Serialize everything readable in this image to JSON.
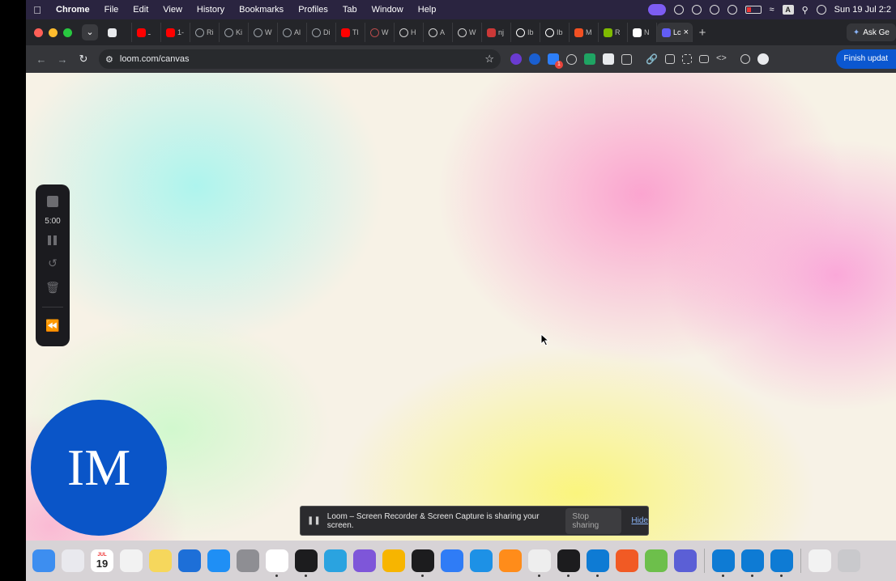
{
  "menubar": {
    "app_name": "Chrome",
    "items": [
      "File",
      "Edit",
      "View",
      "History",
      "Bookmarks",
      "Profiles",
      "Tab",
      "Window",
      "Help"
    ],
    "datetime": "Sun 19 Jul 2:2",
    "keyboard_indicator": "A"
  },
  "tabs": [
    {
      "label": "",
      "icon": "recording-icon",
      "color": "#e8eaed"
    },
    {
      "label": "ـ",
      "icon": "youtube-icon",
      "color": "#ff0000"
    },
    {
      "label": "1-",
      "icon": "youtube-icon",
      "color": "#ff0000"
    },
    {
      "label": "Ri",
      "icon": "circle-icon",
      "color": "#9aa0a6"
    },
    {
      "label": "Ki",
      "icon": "circle-icon",
      "color": "#9aa0a6"
    },
    {
      "label": "W",
      "icon": "circle-icon",
      "color": "#9aa0a6"
    },
    {
      "label": "Al",
      "icon": "circle-icon",
      "color": "#9aa0a6"
    },
    {
      "label": "Di",
      "icon": "circle-icon",
      "color": "#9aa0a6"
    },
    {
      "label": "Tl",
      "icon": "youtube-icon",
      "color": "#ff0000"
    },
    {
      "label": "W",
      "icon": "globe-icon",
      "color": "#b54b4b"
    },
    {
      "label": "H",
      "icon": "openai-icon",
      "color": "#d0d0d0"
    },
    {
      "label": "A",
      "icon": "openai-icon",
      "color": "#d0d0d0"
    },
    {
      "label": "W",
      "icon": "globe-icon",
      "color": "#d0d0d0"
    },
    {
      "label": "nj",
      "icon": "npm-icon",
      "color": "#cb3837"
    },
    {
      "label": "Ib",
      "icon": "github-icon",
      "color": "#ffffff"
    },
    {
      "label": "Ib",
      "icon": "github-icon",
      "color": "#ffffff"
    },
    {
      "label": "M",
      "icon": "microsoft-icon",
      "color": "#f25022"
    },
    {
      "label": "R",
      "icon": "microsoft-icon",
      "color": "#7fba00"
    },
    {
      "label": "N",
      "icon": "ht-icon",
      "color": "#ffffff"
    },
    {
      "label": "Lc",
      "icon": "loom-icon",
      "color": "#625df5",
      "active": true
    }
  ],
  "ask_gemini": "Ask Ge",
  "toolbar": {
    "url": "loom.com/canvas",
    "finish_update": "Finish updat"
  },
  "loom_controls": {
    "timer": "5:00"
  },
  "avatar": {
    "initials": "IM",
    "color": "#0a55c8"
  },
  "share_banner": {
    "message": "Loom – Screen Recorder & Screen Capture is sharing your screen.",
    "stop_label": "Stop sharing",
    "hide_label": "Hide"
  },
  "dock": {
    "calendar_day": "19",
    "calendar_month": "JUL",
    "apps": [
      {
        "name": "finder-icon",
        "color": "#3d8ef0"
      },
      {
        "name": "launchpad-icon",
        "color": "#e9e9ee"
      },
      {
        "name": "calendar-icon",
        "color": "#ffffff"
      },
      {
        "name": "reminders-icon",
        "color": "#f2f2f2"
      },
      {
        "name": "notes-icon",
        "color": "#f6d75c"
      },
      {
        "name": "freeform-icon",
        "color": "#1d6fd8"
      },
      {
        "name": "app-store-icon",
        "color": "#1f8ff5"
      },
      {
        "name": "system-settings-icon",
        "color": "#8e8e93"
      },
      {
        "name": "chrome-icon",
        "color": "#ffffff"
      },
      {
        "name": "terminal-icon",
        "color": "#1c1c1e"
      },
      {
        "name": "telegram-icon",
        "color": "#2aa3e0"
      },
      {
        "name": "obsidian-icon",
        "color": "#7e56d9"
      },
      {
        "name": "sketch-icon",
        "color": "#f7b500"
      },
      {
        "name": "loom-dock-icon",
        "color": "#1c1c1e"
      },
      {
        "name": "mail-icon",
        "color": "#2f7cf6"
      },
      {
        "name": "docker-icon",
        "color": "#1d91e6"
      },
      {
        "name": "sublime-icon",
        "color": "#ff8c1a"
      },
      {
        "name": "instruments-icon",
        "color": "#eeeeee"
      },
      {
        "name": "activity-monitor-icon",
        "color": "#1c1c1e"
      },
      {
        "name": "vscode-icon",
        "color": "#0e7bd4"
      },
      {
        "name": "sublime-s-icon",
        "color": "#f15a24"
      },
      {
        "name": "pycharm-icon",
        "color": "#6dbf4b"
      },
      {
        "name": "copilot-icon",
        "color": "#5b5fd6"
      }
    ],
    "recent_apps": [
      {
        "name": "vscode-icon",
        "color": "#0e7bd4"
      },
      {
        "name": "vscode-icon",
        "color": "#0e7bd4"
      },
      {
        "name": "vscode-icon",
        "color": "#0e7bd4"
      }
    ],
    "trailing": [
      {
        "name": "downloads-icon",
        "color": "#f2f2f2"
      },
      {
        "name": "trash-icon",
        "color": "#c9c9cc"
      }
    ]
  }
}
